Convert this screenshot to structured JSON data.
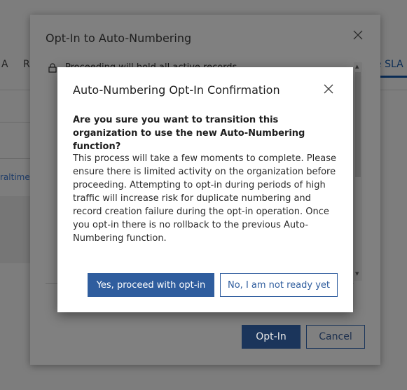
{
  "background": {
    "tabs": [
      {
        "label": "A"
      },
      {
        "label": "R"
      }
    ],
    "right_tab": "e SLA",
    "link_text": "raltime"
  },
  "outer_dialog": {
    "title": "Opt-In to Auto-Numbering",
    "notice_text": "Proceeding will hold all active records...",
    "optin_label": "Opt-In",
    "cancel_label": "Cancel"
  },
  "confirm_dialog": {
    "title": "Auto-Numbering Opt-In Confirmation",
    "question": "Are you sure you want to transition this organization to use the new Auto-Numbering function?",
    "body": "This process will take a few moments to complete. Please ensure there is limited activity on the organization before proceeding. Attempting to opt-in during periods of high traffic will increase risk for duplicate numbering and record creation failure during the opt-in operation. Once you opt-in there is no rollback to the previous Auto-Numbering function.",
    "yes_label": "Yes, proceed with opt-in",
    "no_label": "No, I am not ready yet"
  },
  "colors": {
    "primary": "#2f5d9e",
    "overlay_primary": "#1b355b"
  }
}
